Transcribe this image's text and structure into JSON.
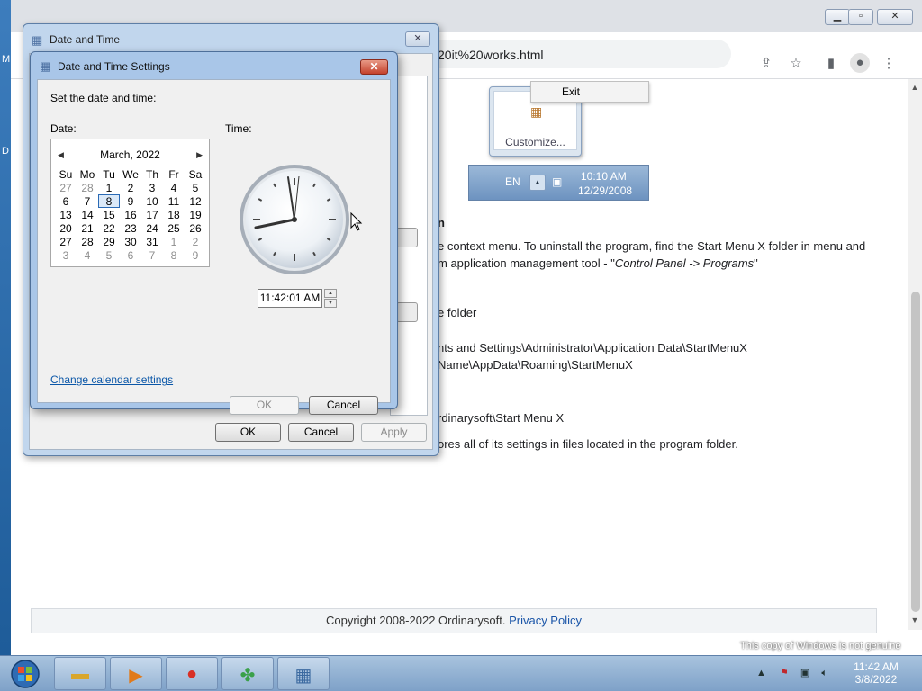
{
  "browser": {
    "url_fragment": "20it%20works.html",
    "content": {
      "heading": "n",
      "lines": [
        "e context menu. To uninstall the program, find the Start Menu X folder in menu and",
        "m application management tool  - \"",
        "Control Panel -> Programs",
        "\"",
        "e folder",
        "nts and Settings\\Administrator\\Application Data\\StartMenuX",
        "Name\\AppData\\Roaming\\StartMenuX",
        "rdinarysoft\\Start Menu X",
        "ores all of its settings in files located in the program folder."
      ],
      "footer_copyright": "Copyright 2008-2022 Ordinarysoft.",
      "footer_link": "Privacy Policy"
    },
    "embedded_image": {
      "context_item": "Exit",
      "customize_label": "Customize...",
      "lang": "EN",
      "time": "10:10 AM",
      "date": "12/29/2008"
    }
  },
  "outer_dialog": {
    "title": "Date and Time",
    "ok_label": "OK",
    "cancel_label": "Cancel",
    "apply_label": "Apply"
  },
  "settings_dialog": {
    "title": "Date and Time Settings",
    "prompt": "Set the date and time:",
    "date_label": "Date:",
    "time_label": "Time:",
    "calendar": {
      "month_label": "March, 2022",
      "weekdays": [
        "Su",
        "Mo",
        "Tu",
        "We",
        "Th",
        "Fr",
        "Sa"
      ],
      "weeks": [
        [
          "27",
          "28",
          "1",
          "2",
          "3",
          "4",
          "5"
        ],
        [
          "6",
          "7",
          "8",
          "9",
          "10",
          "11",
          "12"
        ],
        [
          "13",
          "14",
          "15",
          "16",
          "17",
          "18",
          "19"
        ],
        [
          "20",
          "21",
          "22",
          "23",
          "24",
          "25",
          "26"
        ],
        [
          "27",
          "28",
          "29",
          "30",
          "31",
          "1",
          "2"
        ],
        [
          "3",
          "4",
          "5",
          "6",
          "7",
          "8",
          "9"
        ]
      ],
      "selected_day": "8"
    },
    "time_value": "11:42:01 AM",
    "change_calendar_link": "Change calendar settings",
    "ok_label": "OK",
    "cancel_label": "Cancel"
  },
  "taskbar": {
    "clock_time": "11:42 AM",
    "clock_date": "3/8/2022",
    "genuine_notice": "This copy of Windows is not genuine"
  },
  "colors": {
    "link": "#0b57a8",
    "close_red": "#c4412c",
    "taskbar": "#96b4d4"
  }
}
